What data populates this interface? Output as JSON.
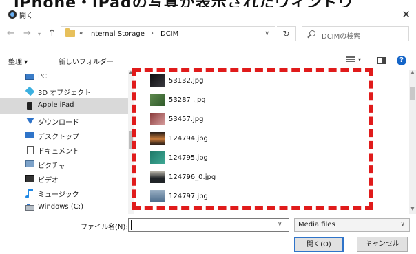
{
  "banner": {
    "text": "iPhone・iPadの写真が表示されたウィンドウ"
  },
  "window": {
    "title": "開く",
    "close": "✕"
  },
  "nav": {
    "back": "←",
    "forward": "→",
    "recent": "▾",
    "up": "↑",
    "path_prefix": "«",
    "path": [
      "Internal Storage",
      "DCIM"
    ],
    "path_sep": "›",
    "refresh": "↻",
    "search_placeholder": "DCIMの検索"
  },
  "toolbar": {
    "organize": "整理 ▾",
    "new_folder": "新しいフォルダー",
    "view_drop": "▾",
    "help": "?"
  },
  "sidebar": {
    "items": [
      {
        "label": "PC",
        "selected": false,
        "icon": "pc-icon"
      },
      {
        "label": "3D オブジェクト",
        "selected": false,
        "icon": "3d-objects-icon"
      },
      {
        "label": "Apple iPad",
        "selected": true,
        "icon": "ipad-icon"
      },
      {
        "label": "ダウンロード",
        "selected": false,
        "icon": "download-icon"
      },
      {
        "label": "デスクトップ",
        "selected": false,
        "icon": "desktop-icon"
      },
      {
        "label": "ドキュメント",
        "selected": false,
        "icon": "documents-icon"
      },
      {
        "label": "ピクチャ",
        "selected": false,
        "icon": "pictures-icon"
      },
      {
        "label": "ビデオ",
        "selected": false,
        "icon": "videos-icon"
      },
      {
        "label": "ミュージック",
        "selected": false,
        "icon": "music-icon"
      },
      {
        "label": "Windows (C:)",
        "selected": false,
        "icon": "drive-icon"
      }
    ]
  },
  "files": [
    {
      "name": "53132.jpg",
      "thumb": [
        "#0e0e10",
        "#3a3a40"
      ]
    },
    {
      "name": "53287 .jpg",
      "thumb": [
        "#5f8a4f",
        "#2f5a2a"
      ]
    },
    {
      "name": "53457.jpg",
      "thumb": [
        "#8a3b3b",
        "#d9a0a0"
      ]
    },
    {
      "name": "124794.jpg",
      "thumb": [
        "#c77a3a",
        "#2a1e18"
      ]
    },
    {
      "name": "124795.jpg",
      "thumb": [
        "#1f7a6a",
        "#3fa894"
      ]
    },
    {
      "name": "124796_0.jpg",
      "thumb": [
        "#202428",
        "#c9c4b8"
      ]
    },
    {
      "name": "124797.jpg",
      "thumb": [
        "#4a6a8a",
        "#9ab0c4"
      ]
    }
  ],
  "scroll": {
    "up": "▲",
    "down": "▼"
  },
  "bottom": {
    "filename_label": "ファイル名(N):",
    "filename_value": "",
    "filename_drop": "∨",
    "filetype": "Media files",
    "filetype_drop": "∨",
    "open": "開く(O)",
    "cancel": "キャンセル"
  },
  "colors": {
    "accent": "#2f74c9",
    "highlight": "#e01b1b",
    "selected_bg": "#d9d9d9"
  }
}
